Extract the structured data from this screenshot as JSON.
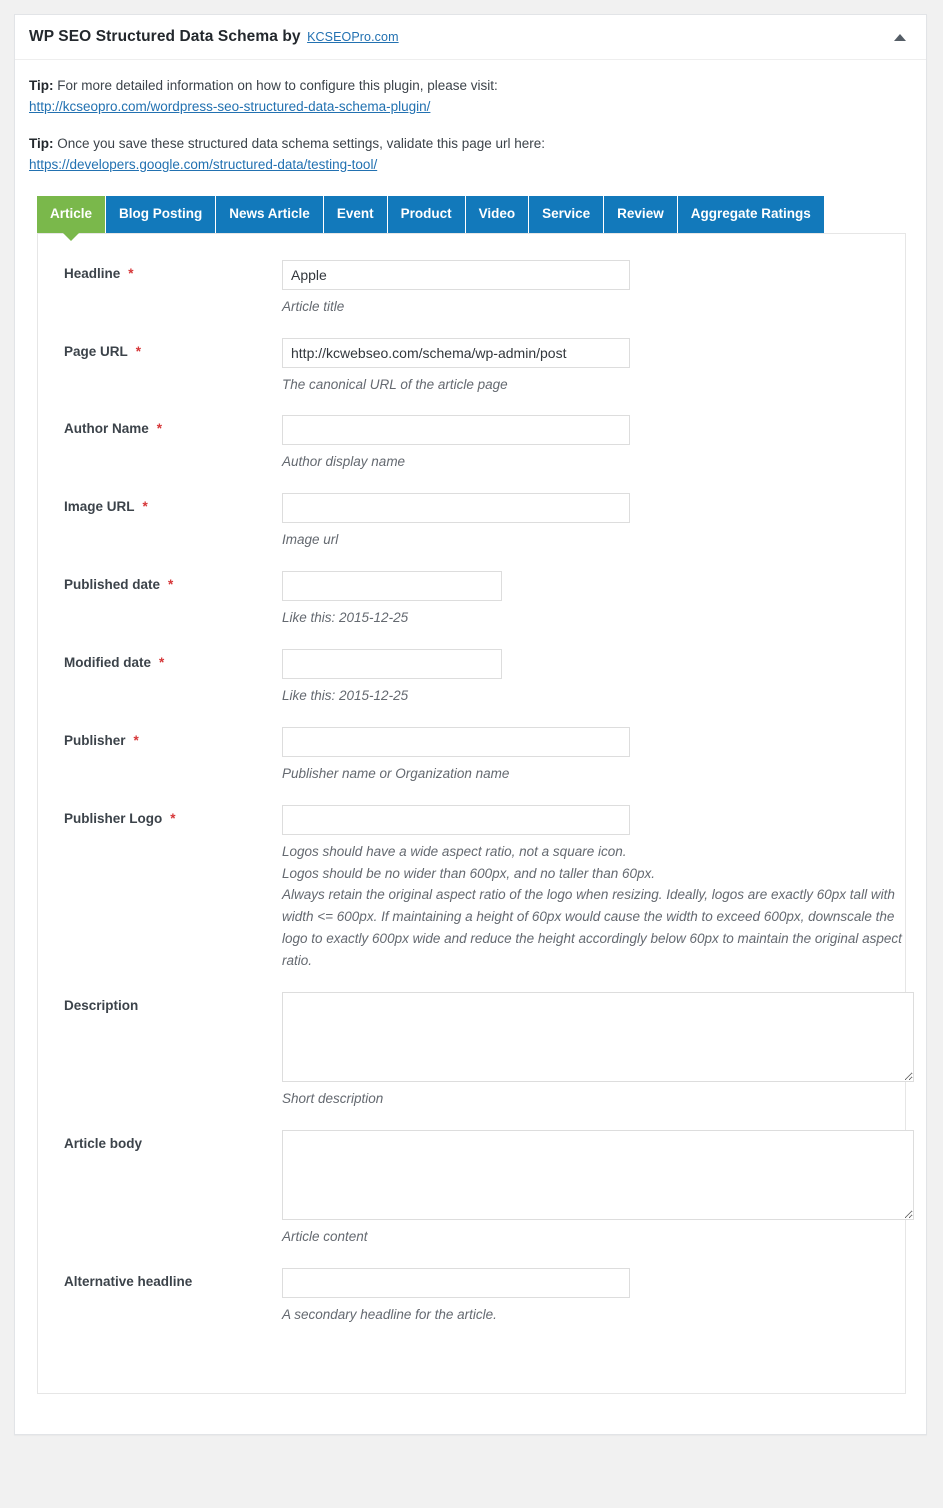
{
  "panel": {
    "title": "WP SEO Structured Data Schema by",
    "title_link": "KCSEOPro.com",
    "toggle_icon": "caret-up-icon"
  },
  "tips": [
    {
      "label": "Tip:",
      "text": " For more detailed information on how to configure this plugin, please visit:",
      "link": "http://kcseopro.com/wordpress-seo-structured-data-schema-plugin/"
    },
    {
      "label": "Tip:",
      "text": " Once you save these structured data schema settings, validate this page url here:",
      "link": "https://developers.google.com/structured-data/testing-tool/"
    }
  ],
  "tabs": [
    {
      "label": "Article",
      "active": true
    },
    {
      "label": "Blog Posting",
      "active": false
    },
    {
      "label": "News Article",
      "active": false
    },
    {
      "label": "Event",
      "active": false
    },
    {
      "label": "Product",
      "active": false
    },
    {
      "label": "Video",
      "active": false
    },
    {
      "label": "Service",
      "active": false
    },
    {
      "label": "Review",
      "active": false
    },
    {
      "label": "Aggregate Ratings",
      "active": false
    }
  ],
  "colors": {
    "tab_active": "#7ab84b",
    "tab_inactive": "#1279bb",
    "required_star": "#d63638",
    "link": "#2271b1"
  },
  "form": {
    "required_marker": "*",
    "fields": [
      {
        "label": "Headline",
        "required": true,
        "value": "Apple",
        "help": [
          "Article title"
        ]
      },
      {
        "label": "Page URL",
        "required": true,
        "value": "http://kcwebseo.com/schema/wp-admin/post",
        "help": [
          "The canonical URL of the article page"
        ]
      },
      {
        "label": "Author Name",
        "required": true,
        "value": "",
        "help": [
          "Author display name"
        ]
      },
      {
        "label": "Image URL",
        "required": true,
        "value": "",
        "help": [
          "Image url"
        ]
      },
      {
        "label": "Published date",
        "required": true,
        "value": "",
        "help": [
          "Like this: 2015-12-25"
        ]
      },
      {
        "label": "Modified date",
        "required": true,
        "value": "",
        "help": [
          "Like this: 2015-12-25"
        ]
      },
      {
        "label": "Publisher",
        "required": true,
        "value": "",
        "help": [
          "Publisher name or Organization name"
        ]
      },
      {
        "label": "Publisher Logo",
        "required": true,
        "value": "",
        "help": [
          "Logos should have a wide aspect ratio, not a square icon.",
          "Logos should be no wider than 600px, and no taller than 60px.",
          "Always retain the original aspect ratio of the logo when resizing. Ideally, logos are exactly 60px tall with width <= 600px. If maintaining a height of 60px would cause the width to exceed 600px, downscale the logo to exactly 600px wide and reduce the height accordingly below 60px to maintain the original aspect ratio."
        ]
      },
      {
        "label": "Description",
        "required": false,
        "value": "",
        "help": [
          "Short description"
        ]
      },
      {
        "label": "Article body",
        "required": false,
        "value": "",
        "help": [
          "Article content"
        ]
      },
      {
        "label": "Alternative headline",
        "required": false,
        "value": "",
        "help": [
          "A secondary headline for the article."
        ]
      }
    ]
  }
}
